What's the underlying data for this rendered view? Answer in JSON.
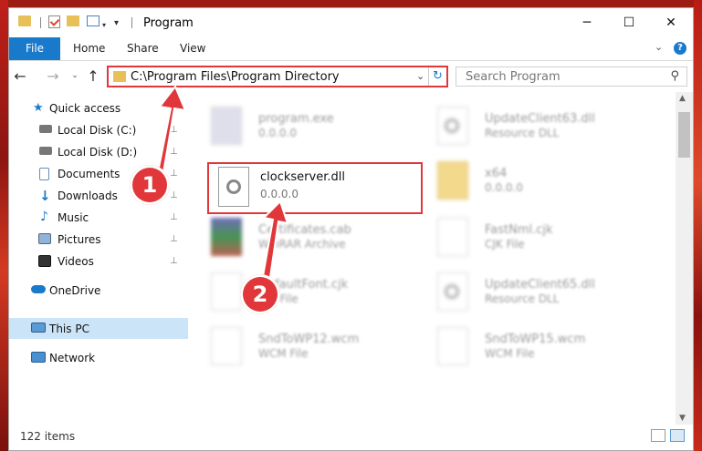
{
  "window": {
    "title": "Program",
    "controls": {
      "minimize": "─",
      "maximize": "☐",
      "close": "✕"
    }
  },
  "ribbon": {
    "tabs": [
      "File",
      "Home",
      "Share",
      "View"
    ],
    "chevron": "⌄",
    "help": "?"
  },
  "nav": {
    "back": "←",
    "forward": "→",
    "dropdown": "⌄",
    "up": "↑",
    "address": "C:\\Program Files\\Program Directory",
    "address_dropdown": "⌄",
    "refresh": "↻",
    "search_placeholder": "Search Program",
    "search_icon": "⚲"
  },
  "sidebar": {
    "items": [
      {
        "label": "Quick access",
        "icon": "star-icon",
        "pinned": false
      },
      {
        "label": "Local Disk (C:)",
        "icon": "drive-icon",
        "pinned": true
      },
      {
        "label": "Local Disk (D:)",
        "icon": "drive-icon",
        "pinned": true
      },
      {
        "label": "Documents",
        "icon": "documents-icon",
        "pinned": true
      },
      {
        "label": "Downloads",
        "icon": "download-icon",
        "pinned": true
      },
      {
        "label": "Music",
        "icon": "music-icon",
        "pinned": true
      },
      {
        "label": "Pictures",
        "icon": "pictures-icon",
        "pinned": true
      },
      {
        "label": "Videos",
        "icon": "videos-icon",
        "pinned": true
      },
      {
        "label": "OneDrive",
        "icon": "cloud-icon",
        "pinned": false
      },
      {
        "label": "This PC",
        "icon": "pc-icon",
        "pinned": false,
        "selected": true
      },
      {
        "label": "Network",
        "icon": "network-icon",
        "pinned": false
      }
    ],
    "pin_glyph": "📌"
  },
  "files": {
    "left": [
      {
        "name": "program.exe",
        "sub": "0.0.0.0",
        "icon": "exe-icon"
      },
      {
        "name": "clockserver.dll",
        "sub": "0.0.0.0",
        "icon": "dll-icon",
        "highlighted": true
      },
      {
        "name": "Certificates.cab",
        "sub": "WinRAR Archive",
        "icon": "rar-icon"
      },
      {
        "name": "DefaultFont.cjk",
        "sub": "CJK File",
        "icon": "file-icon"
      },
      {
        "name": "SndToWP12.wcm",
        "sub": "WCM File",
        "icon": "file-icon"
      }
    ],
    "right": [
      {
        "name": "UpdateClient63.dll",
        "sub": "Resource DLL",
        "icon": "dll-icon"
      },
      {
        "name": "x64",
        "sub": "0.0.0.0",
        "icon": "folder-icon"
      },
      {
        "name": "FastNml.cjk",
        "sub": "CJK File",
        "icon": "file-icon"
      },
      {
        "name": "UpdateClient65.dll",
        "sub": "Resource DLL",
        "icon": "dll-icon"
      },
      {
        "name": "SndToWP15.wcm",
        "sub": "WCM File",
        "icon": "file-icon"
      }
    ]
  },
  "callouts": [
    "1",
    "2"
  ],
  "status": {
    "items": "122 items"
  },
  "colors": {
    "accent": "#1979ca",
    "highlight": "#e1373a",
    "selected": "#cce4f7"
  }
}
